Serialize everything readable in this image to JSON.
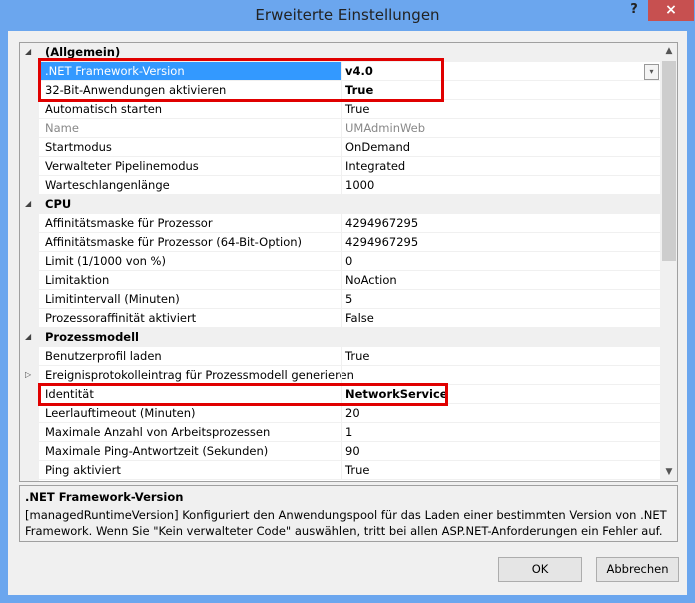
{
  "window": {
    "title": "Erweiterte Einstellungen",
    "help": "?",
    "close": "×"
  },
  "rows": [
    {
      "type": "cat",
      "name": "(Allgemein)",
      "expander": "◢"
    },
    {
      "name": ".NET Framework-Version",
      "value": "v4.0",
      "bold": true,
      "selected": true
    },
    {
      "name": "32-Bit-Anwendungen aktivieren",
      "value": "True",
      "bold": true
    },
    {
      "name": "Automatisch starten",
      "value": "True"
    },
    {
      "name": "Name",
      "value": "UMAdminWeb",
      "disabled": true
    },
    {
      "name": "Startmodus",
      "value": "OnDemand"
    },
    {
      "name": "Verwalteter Pipelinemodus",
      "value": "Integrated"
    },
    {
      "name": "Warteschlangenlänge",
      "value": "1000"
    },
    {
      "type": "cat",
      "name": "CPU",
      "expander": "◢"
    },
    {
      "name": "Affinitätsmaske für Prozessor",
      "value": "4294967295"
    },
    {
      "name": "Affinitätsmaske für Prozessor (64-Bit-Option)",
      "value": "4294967295"
    },
    {
      "name": "Limit (1/1000 von %)",
      "value": "0"
    },
    {
      "name": "Limitaktion",
      "value": "NoAction"
    },
    {
      "name": "Limitintervall (Minuten)",
      "value": "5"
    },
    {
      "name": "Prozessoraffinität aktiviert",
      "value": "False"
    },
    {
      "type": "cat",
      "name": "Prozessmodell",
      "expander": "◢"
    },
    {
      "name": "Benutzerprofil laden",
      "value": "True"
    },
    {
      "name": "Ereignisprotokolleintrag für Prozessmodell generieren",
      "value": "",
      "expander": "▷"
    },
    {
      "name": "Identität",
      "value": "NetworkService",
      "bold": true
    },
    {
      "name": "Leerlauftimeout (Minuten)",
      "value": "20"
    },
    {
      "name": "Maximale Anzahl von Arbeitsprozessen",
      "value": "1"
    },
    {
      "name": "Maximale Ping-Antwortzeit (Sekunden)",
      "value": "90"
    },
    {
      "name": "Ping aktiviert",
      "value": "True"
    }
  ],
  "dropdown_icon": "▾",
  "scroll": {
    "up": "▲",
    "down": "▼"
  },
  "description": {
    "title": ".NET Framework-Version",
    "text": " [managedRuntimeVersion] Konfiguriert den Anwendungspool für das Laden einer bestimmten Version von .NET Framework. Wenn Sie \"Kein verwalteter Code\" auswählen, tritt bei allen ASP.NET-Anforderungen ein Fehler auf."
  },
  "buttons": {
    "ok": "OK",
    "cancel": "Abbrechen"
  }
}
